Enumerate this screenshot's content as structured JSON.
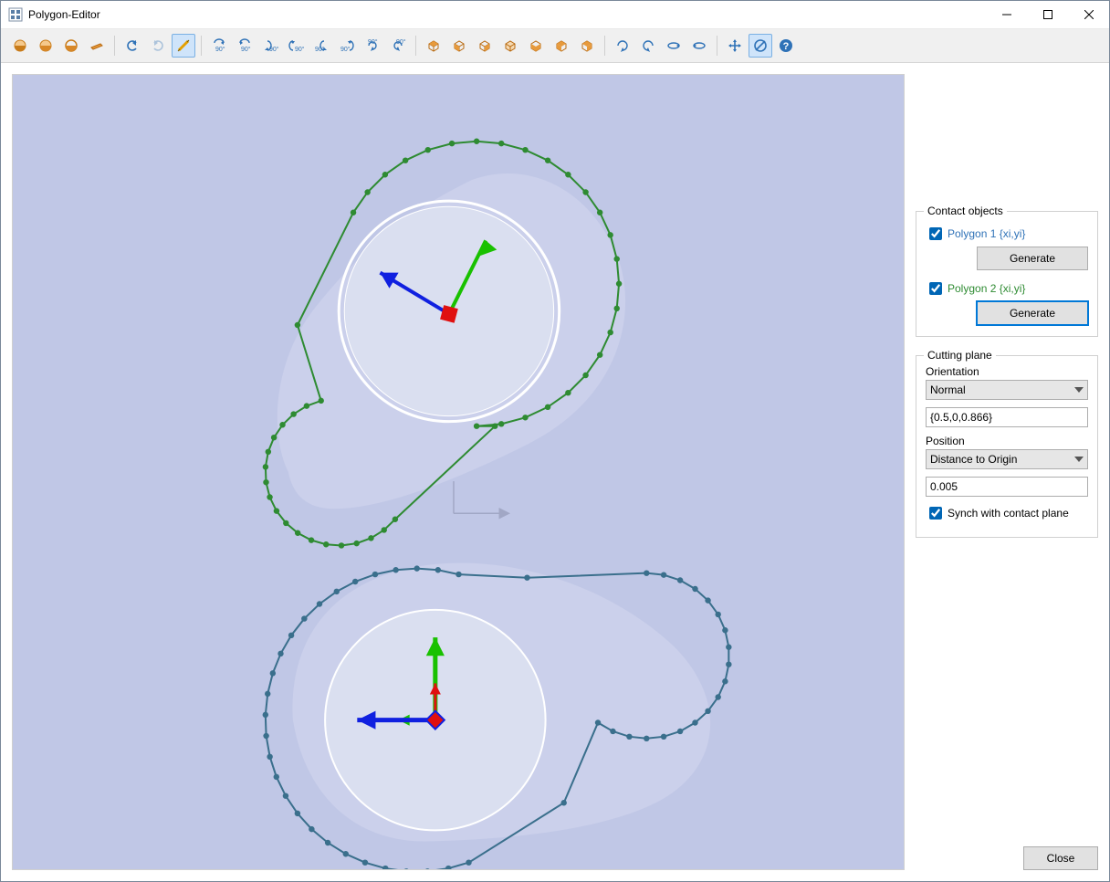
{
  "window": {
    "title": "Polygon-Editor"
  },
  "toolbar_icons": {
    "hemi1": "hemisphere-a",
    "hemi2": "hemisphere-b",
    "hemi3": "hemisphere-c",
    "slab": "slab",
    "undo": "undo",
    "redo": "redo",
    "measure": "measure",
    "rot_a": "rot-y-down",
    "rot_b": "rot-y-cw",
    "rot_c": "rot-y-ccw",
    "rot_d": "rot-y-up",
    "rot_e": "rot-x-cw",
    "rot_f": "rot-x-ccw",
    "rot_g": "rot-z-cw",
    "rot_h": "rot-z-ccw",
    "cube1": "iso-front",
    "cube2": "iso-back",
    "cube3": "iso-left",
    "cube4": "iso-right",
    "cube5": "iso-top",
    "cube6": "iso-bottom",
    "cube7": "iso-ortho",
    "r1": "rot-view-1",
    "r2": "rot-view-2",
    "r3": "rot-view-3",
    "r4": "rot-view-4",
    "pan": "pan",
    "disc": "cutting-plane",
    "help": "help"
  },
  "contact_objects": {
    "legend": "Contact objects",
    "polygon1": {
      "label": "Polygon 1 {xi,yi}",
      "checked": true,
      "generate_label": "Generate"
    },
    "polygon2": {
      "label": "Polygon 2 {xi,yi}",
      "checked": true,
      "generate_label": "Generate"
    }
  },
  "cutting_plane": {
    "legend": "Cutting plane",
    "orientation_label": "Orientation",
    "orientation_options": [
      "Normal"
    ],
    "orientation_selected": "Normal",
    "orientation_value": "{0.5,0,0.866}",
    "position_label": "Position",
    "position_options": [
      "Distance to Origin"
    ],
    "position_selected": "Distance to Origin",
    "position_value": "0.005",
    "sync_label": "Synch with contact plane",
    "sync_checked": true
  },
  "buttons": {
    "close": "Close"
  },
  "chart_data": {
    "type": "diagram",
    "note": "3D contact/editor viewport showing two polygon outlines (green=Polygon 1, blue=Polygon 2) over grey blob shapes with inner circles and coordinate axis triads (red/green/blue arrows)."
  }
}
